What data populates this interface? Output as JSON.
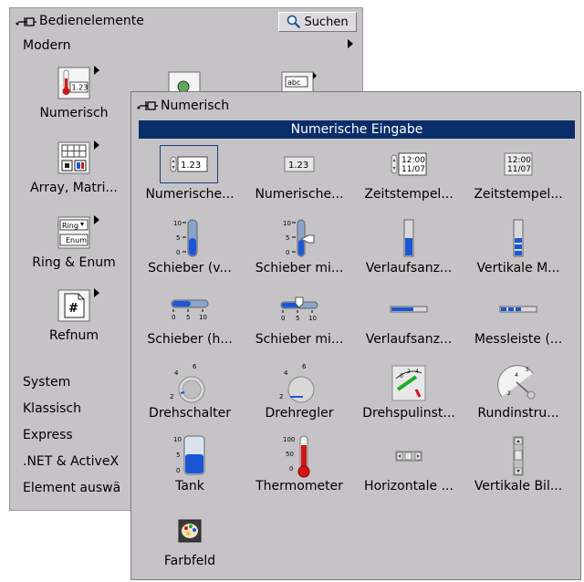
{
  "back_palette": {
    "title": "Bedienelemente",
    "search_label": "Suchen",
    "category": "Modern",
    "items": [
      {
        "label": "Numerisch",
        "icon": "numeric-thermometer-icon"
      },
      {
        "label": "Array, Matri...",
        "icon": "array-matrix-icon"
      },
      {
        "label": "Ring & Enum",
        "icon": "ring-enum-icon"
      },
      {
        "label": "Refnum",
        "icon": "refnum-icon"
      }
    ],
    "subcategories": [
      "System",
      "Klassisch",
      "Express",
      ".NET & ActiveX",
      "Element auswä"
    ]
  },
  "front_palette": {
    "title": "Numerisch",
    "header": "Numerische Eingabe",
    "items": [
      {
        "label": "Numerische...",
        "icon": "numeric-control-icon"
      },
      {
        "label": "Numerische...",
        "icon": "numeric-indicator-icon"
      },
      {
        "label": "Zeitstempel...",
        "icon": "timestamp-control-icon"
      },
      {
        "label": "Zeitstempel...",
        "icon": "timestamp-indicator-icon"
      },
      {
        "label": "Schieber (v...",
        "icon": "vertical-slide-icon"
      },
      {
        "label": "Schieber mi...",
        "icon": "vertical-pointer-slide-icon"
      },
      {
        "label": "Verlaufsanz...",
        "icon": "vertical-progress-bar-icon"
      },
      {
        "label": "Vertikale M...",
        "icon": "vertical-graduated-bar-icon"
      },
      {
        "label": "Schieber (h...",
        "icon": "horizontal-slide-icon"
      },
      {
        "label": "Schieber mi...",
        "icon": "horizontal-pointer-slide-icon"
      },
      {
        "label": "Verlaufsanz...",
        "icon": "horizontal-progress-bar-icon"
      },
      {
        "label": "Messleiste (...",
        "icon": "horizontal-graduated-bar-icon"
      },
      {
        "label": "Drehschalter",
        "icon": "knob-icon"
      },
      {
        "label": "Drehregler",
        "icon": "dial-icon"
      },
      {
        "label": "Drehspulinst...",
        "icon": "meter-icon"
      },
      {
        "label": "Rundinstru...",
        "icon": "gauge-icon"
      },
      {
        "label": "Tank",
        "icon": "tank-icon"
      },
      {
        "label": "Thermometer",
        "icon": "thermometer-icon"
      },
      {
        "label": "Horizontale ...",
        "icon": "horizontal-scrollbar-icon"
      },
      {
        "label": "Vertikale Bil...",
        "icon": "vertical-scrollbar-icon"
      },
      {
        "label": "Farbfeld",
        "icon": "color-box-icon"
      }
    ],
    "icon_texts": {
      "numeric": "1.23",
      "time": "12:00",
      "date": "11/07",
      "tick_10": "10",
      "tick_5": "5",
      "tick_0": "0",
      "tick_100": "100",
      "tick_50": "50",
      "abc": "abc",
      "ring": "Ring",
      "enum": "Enum",
      "hash": "#"
    }
  },
  "colors": {
    "palette_bg": "#c6c3c6",
    "header_bg": "#0a2e6a",
    "header_fg": "#ffffff",
    "slider_blue": "#1a57d6",
    "thermo_red": "#d11515"
  }
}
